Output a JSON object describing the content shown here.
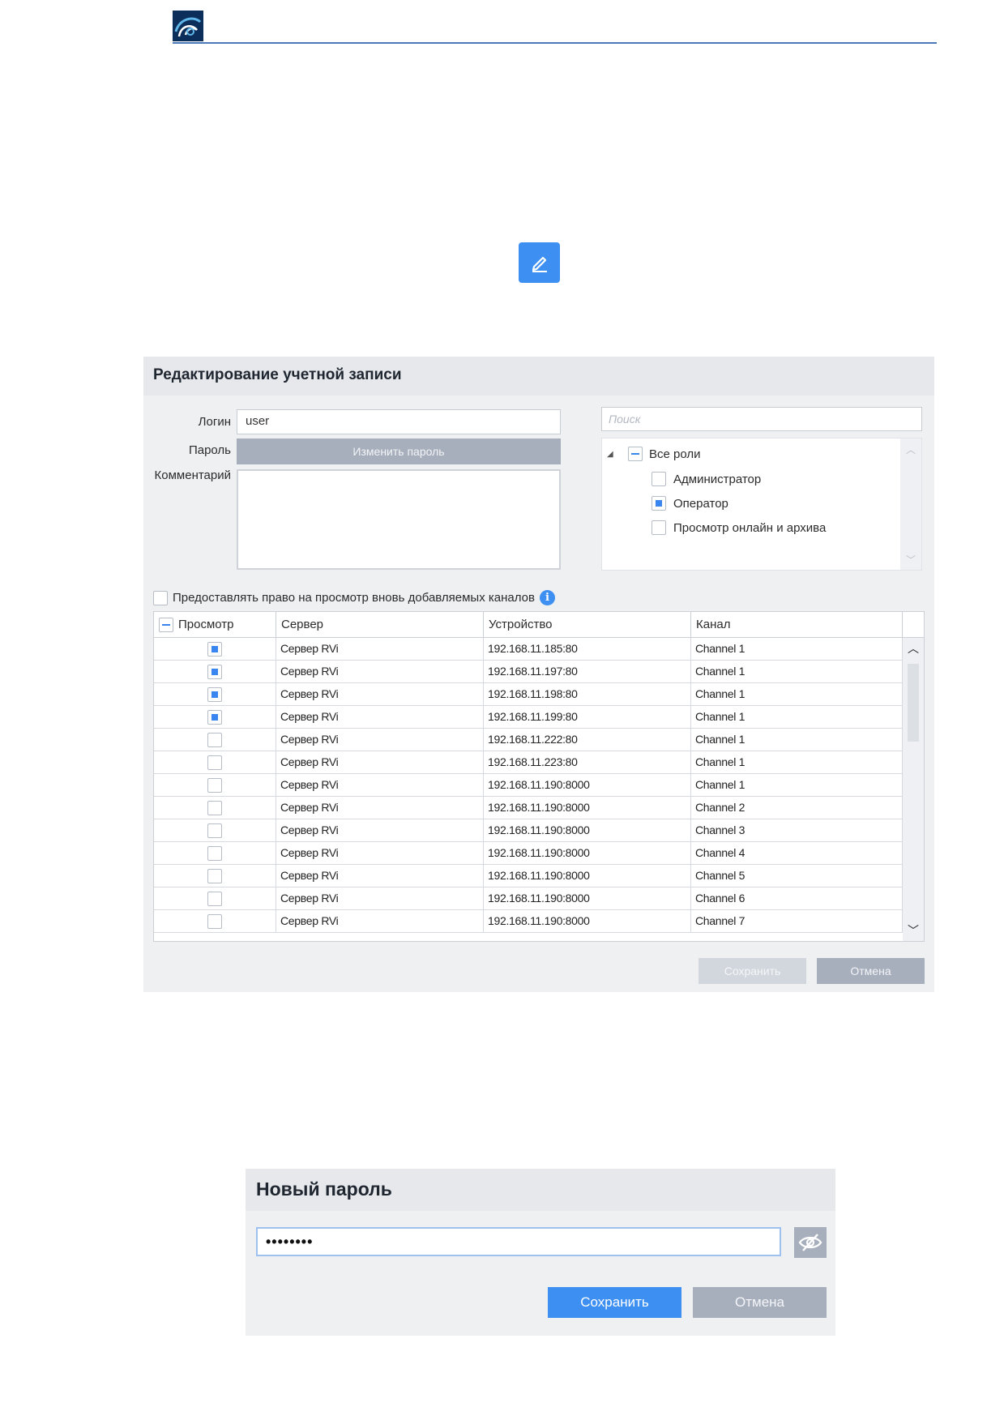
{
  "edit_dialog": {
    "title": "Редактирование учетной записи",
    "login_label": "Логин",
    "login_value": "user",
    "password_label": "Пароль",
    "change_password": "Изменить пароль",
    "comment_label": "Комментарий",
    "search_placeholder": "Поиск",
    "roles": {
      "root": "Все роли",
      "items": [
        {
          "label": "Администратор",
          "checked": false
        },
        {
          "label": "Оператор",
          "checked": true
        },
        {
          "label": "Просмотр онлайн и архива",
          "checked": false
        }
      ]
    },
    "grant_label": "Предоставлять право на просмотр вновь добавляемых каналов",
    "table": {
      "headers": [
        "Просмотр",
        "Сервер",
        "Устройство",
        "Канал"
      ],
      "rows": [
        {
          "view": true,
          "server": "Сервер RVi",
          "device": "192.168.11.185:80",
          "channel": "Channel 1"
        },
        {
          "view": true,
          "server": "Сервер RVi",
          "device": "192.168.11.197:80",
          "channel": "Channel 1"
        },
        {
          "view": true,
          "server": "Сервер RVi",
          "device": "192.168.11.198:80",
          "channel": "Channel 1"
        },
        {
          "view": true,
          "server": "Сервер RVi",
          "device": "192.168.11.199:80",
          "channel": "Channel 1"
        },
        {
          "view": false,
          "server": "Сервер RVi",
          "device": "192.168.11.222:80",
          "channel": "Channel 1"
        },
        {
          "view": false,
          "server": "Сервер RVi",
          "device": "192.168.11.223:80",
          "channel": "Channel 1"
        },
        {
          "view": false,
          "server": "Сервер RVi",
          "device": "192.168.11.190:8000",
          "channel": "Channel 1"
        },
        {
          "view": false,
          "server": "Сервер RVi",
          "device": "192.168.11.190:8000",
          "channel": "Channel 2"
        },
        {
          "view": false,
          "server": "Сервер RVi",
          "device": "192.168.11.190:8000",
          "channel": "Channel 3"
        },
        {
          "view": false,
          "server": "Сервер RVi",
          "device": "192.168.11.190:8000",
          "channel": "Channel 4"
        },
        {
          "view": false,
          "server": "Сервер RVi",
          "device": "192.168.11.190:8000",
          "channel": "Channel 5"
        },
        {
          "view": false,
          "server": "Сервер RVi",
          "device": "192.168.11.190:8000",
          "channel": "Channel 6"
        },
        {
          "view": false,
          "server": "Сервер RVi",
          "device": "192.168.11.190:8000",
          "channel": "Channel 7"
        }
      ]
    },
    "save": "Сохранить",
    "cancel": "Отмена"
  },
  "password_dialog": {
    "title": "Новый пароль",
    "value": "••••••••",
    "save": "Сохранить",
    "cancel": "Отмена"
  },
  "icons": {
    "logo": "logo-icon",
    "edit": "pencil-icon",
    "info": "info-icon",
    "eye": "eye-hidden-icon"
  },
  "colors": {
    "accent": "#3d8ff2",
    "disabled_button": "#a8afbc",
    "checkbox_fill": "#3a86f0"
  }
}
